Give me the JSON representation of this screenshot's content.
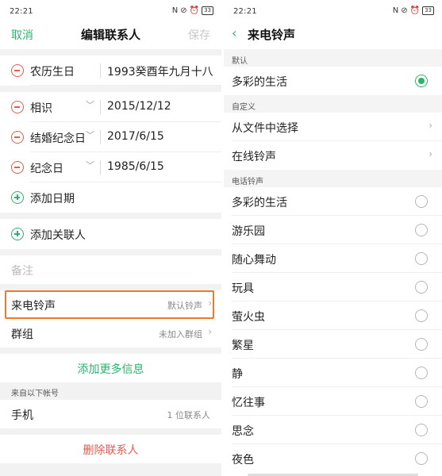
{
  "left": {
    "status": {
      "time": "22:21",
      "signal": "5ıl 5ıl",
      "wifi": "wifi",
      "network": "Nfc",
      "battery": "33"
    },
    "nav": {
      "cancel": "取消",
      "title": "编辑联系人",
      "save": "保存"
    },
    "dates": [
      {
        "label": "农历生日",
        "value": "1993癸酉年九月十八",
        "dropdown": false
      },
      {
        "label": "相识",
        "value": "2015/12/12",
        "dropdown": true
      },
      {
        "label": "结婚纪念日",
        "value": "2017/6/15",
        "dropdown": true
      },
      {
        "label": "纪念日",
        "value": "1985/6/15",
        "dropdown": true
      }
    ],
    "add_date": "添加日期",
    "add_related": "添加关联人",
    "note": "备注",
    "ringtone": {
      "label": "来电铃声",
      "value": "默认铃声"
    },
    "group": {
      "label": "群组",
      "value": "未加入群组"
    },
    "add_more": "添加更多信息",
    "account_header": "来自以下帐号",
    "account": {
      "label": "手机",
      "value": "1 位联系人"
    },
    "delete": "删除联系人"
  },
  "right": {
    "status": {
      "time": "22:21",
      "signal": "5ıl 5ıl",
      "battery": "33"
    },
    "nav": {
      "back": "‹",
      "title": "来电铃声"
    },
    "sections": {
      "default": "默认",
      "custom": "自定义",
      "phone": "电话铃声"
    },
    "default_item": {
      "label": "多彩的生活",
      "selected": true
    },
    "custom_items": [
      {
        "label": "从文件中选择"
      },
      {
        "label": "在线铃声"
      }
    ],
    "phone_items": [
      {
        "label": "多彩的生活"
      },
      {
        "label": "游乐园"
      },
      {
        "label": "随心舞动"
      },
      {
        "label": "玩具"
      },
      {
        "label": "萤火虫"
      },
      {
        "label": "繁星"
      },
      {
        "label": "静"
      },
      {
        "label": "忆往事"
      },
      {
        "label": "思念"
      },
      {
        "label": "夜色"
      }
    ]
  },
  "colors": {
    "accent": "#2db36b",
    "danger": "#e55b4f",
    "highlight": "#f0782c"
  }
}
